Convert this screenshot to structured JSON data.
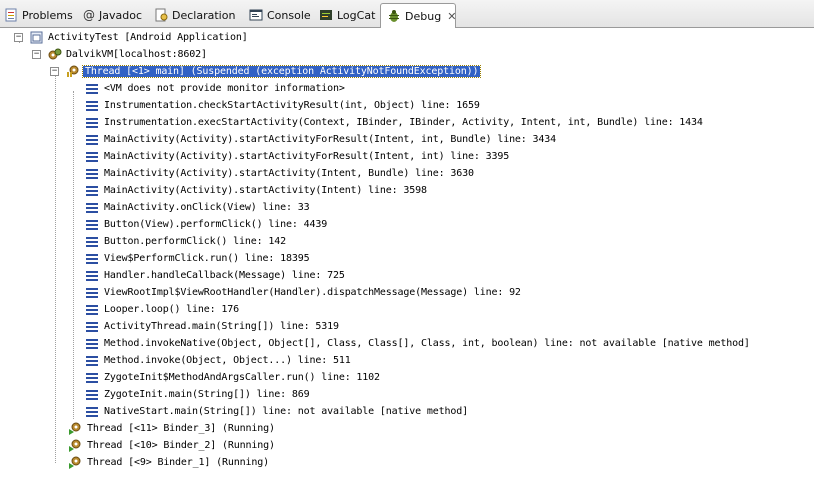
{
  "tabs": [
    {
      "label": "Problems",
      "icon": "problems-icon"
    },
    {
      "label": "Javadoc",
      "icon": "javadoc-icon"
    },
    {
      "label": "Declaration",
      "icon": "declaration-icon"
    },
    {
      "label": "Console",
      "icon": "console-icon"
    },
    {
      "label": "LogCat",
      "icon": "logcat-icon"
    },
    {
      "label": "Debug",
      "icon": "debug-icon",
      "active": true
    }
  ],
  "tree": {
    "launch": "ActivityTest [Android Application]",
    "vm": "DalvikVM[localhost:8602]",
    "suspended_thread": "Thread [<1> main] (Suspended (exception ActivityNotFoundException))",
    "frames": [
      "<VM does not provide monitor information>",
      "Instrumentation.checkStartActivityResult(int, Object) line: 1659",
      "Instrumentation.execStartActivity(Context, IBinder, IBinder, Activity, Intent, int, Bundle) line: 1434",
      "MainActivity(Activity).startActivityForResult(Intent, int, Bundle) line: 3434",
      "MainActivity(Activity).startActivityForResult(Intent, int) line: 3395",
      "MainActivity(Activity).startActivity(Intent, Bundle) line: 3630",
      "MainActivity(Activity).startActivity(Intent) line: 3598",
      "MainActivity.onClick(View) line: 33",
      "Button(View).performClick() line: 4439",
      "Button.performClick() line: 142",
      "View$PerformClick.run() line: 18395",
      "Handler.handleCallback(Message) line: 725",
      "ViewRootImpl$ViewRootHandler(Handler).dispatchMessage(Message) line: 92",
      "Looper.loop() line: 176",
      "ActivityThread.main(String[]) line: 5319",
      "Method.invokeNative(Object, Object[], Class, Class[], Class, int, boolean) line: not available [native method]",
      "Method.invoke(Object, Object...) line: 511",
      "ZygoteInit$MethodAndArgsCaller.run() line: 1102",
      "ZygoteInit.main(String[]) line: 869",
      "NativeStart.main(String[]) line: not available [native method]"
    ],
    "running_threads": [
      "Thread [<11> Binder_3] (Running)",
      "Thread [<10> Binder_2] (Running)",
      "Thread [<9> Binder_1] (Running)"
    ]
  },
  "colors": {
    "selection": "#3161c4",
    "frame_icon": "#2b4ea2"
  }
}
